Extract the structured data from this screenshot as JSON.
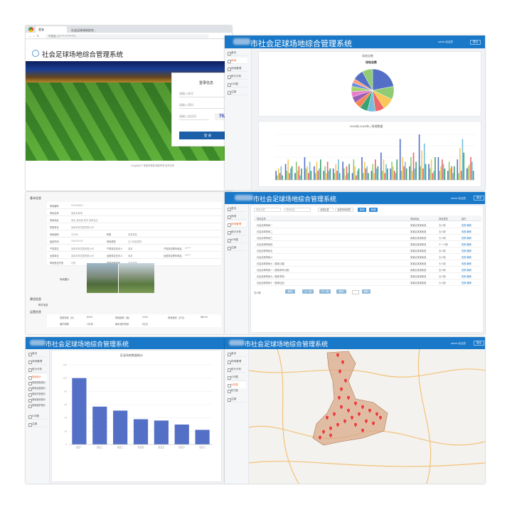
{
  "browser": {
    "tab1": "登录",
    "tab2": "社会足球场地综合...",
    "url": "不安全 | 1**.**.**.***:***/..."
  },
  "app_title": "社会足球场地综合管理系统",
  "app_title_full": "社会足球场地综合管理系统",
  "city_prefix": "市",
  "login": {
    "title": "登录信息",
    "user_placeholder": "请输入账号",
    "pass_placeholder": "请输入密码",
    "captcha_placeholder": "请输入验证码",
    "captcha": "T5J!",
    "button": "登 录",
    "footer": "Copyright © 某某体育局 版权所有 技术支持"
  },
  "user": {
    "name": "admin 欢迎您",
    "exit": "退出"
  },
  "nav": {
    "home": "首页",
    "stadium": "场地",
    "stadium_mgmt": "场地管理",
    "stats": "统计分析",
    "gis": "GIS图",
    "logout": "注销"
  },
  "dashboard": {
    "card1_title": "场地总数",
    "pie_title": "场地总数",
    "card2_title": "2016年-2020年 | 场地数量",
    "pie_colors": [
      "#5470c6",
      "#91cc75",
      "#fac858",
      "#ee6666",
      "#73c0de",
      "#3ba272",
      "#fc8452",
      "#9a60b4",
      "#ea7ccc",
      "#a5d36b",
      "#6b8ce0",
      "#ff9f7f"
    ]
  },
  "chart_data": [
    {
      "type": "pie",
      "title": "场地总数",
      "values": [
        22,
        10,
        9,
        7,
        6,
        6,
        5,
        5,
        4,
        4,
        3,
        3,
        8,
        8
      ]
    },
    {
      "type": "bar",
      "title": "2016年-2020年 | 场地数量",
      "series_count": 6,
      "categories": [
        "1",
        "2",
        "3",
        "4",
        "5",
        "6",
        "7",
        "8",
        "9",
        "10",
        "11",
        "12",
        "13",
        "14",
        "15",
        "16",
        "17",
        "18",
        "19",
        "20",
        "21"
      ],
      "series": [
        {
          "values": [
            4,
            7,
            3,
            10,
            6,
            4,
            5,
            8,
            3,
            10,
            4,
            12,
            5,
            18,
            6,
            20,
            7,
            10,
            4,
            9,
            5
          ]
        },
        {
          "values": [
            2,
            4,
            8,
            5,
            3,
            6,
            3,
            5,
            9,
            3,
            7,
            4,
            8,
            4,
            10,
            6,
            5,
            4,
            8,
            3,
            6
          ]
        },
        {
          "values": [
            5,
            9,
            4,
            6,
            8,
            3,
            7,
            2,
            6,
            8,
            3,
            9,
            6,
            10,
            4,
            13,
            9,
            6,
            5,
            14,
            7
          ]
        },
        {
          "values": [
            3,
            3,
            6,
            3,
            4,
            8,
            4,
            6,
            2,
            5,
            9,
            3,
            4,
            6,
            12,
            5,
            3,
            9,
            6,
            4,
            10
          ]
        },
        {
          "values": [
            6,
            5,
            2,
            8,
            5,
            4,
            9,
            3,
            4,
            6,
            5,
            7,
            3,
            8,
            5,
            16,
            4,
            7,
            3,
            18,
            8
          ]
        },
        {
          "values": [
            2,
            6,
            5,
            4,
            9,
            5,
            3,
            7,
            5,
            3,
            6,
            5,
            9,
            5,
            8,
            7,
            10,
            5,
            6,
            12,
            4
          ]
        }
      ]
    },
    {
      "type": "bar",
      "title": "区县场地数量统计",
      "categories": [
        "区县一",
        "区县二",
        "区县三",
        "区县四",
        "区县五",
        "区县六",
        "区县七"
      ],
      "values": [
        100,
        57,
        51,
        38,
        36,
        30,
        22
      ],
      "ylim": [
        0,
        120
      ]
    }
  ],
  "detail": {
    "section1": "基本信息",
    "section2": "建设信息",
    "section3": "附件信息",
    "section4": "场地图片",
    "section5": "运营信息",
    "rows": [
      [
        "场地编号",
        "SC0000001"
      ],
      [
        "场地名称",
        "某某足球场"
      ],
      [
        "场地地址",
        "某区 某街道 某号 某某社区"
      ],
      [
        "所属单位",
        "某某体育发展有限公司"
      ],
      [
        "场地面积",
        "平方米",
        "所属",
        "某某类型"
      ],
      [
        "建设时间",
        "2016-09-05",
        "场地类型",
        "五人制足球场"
      ],
      [
        "产权单位",
        "某某体育发展有限公司",
        "产权单位负责人",
        "某某",
        "产权单位联系电话",
        "13****"
      ],
      [
        "运营单位",
        "某某体育发展有限公司",
        "运营单位负责人",
        "某某",
        "运营单位联系电话",
        "13****"
      ],
      [
        "场地是否开放",
        "开放",
        "场地开放时间",
        "全天开放"
      ]
    ],
    "photo_label": "场地图片",
    "fee_label": "收费标准（元）",
    "fee_value": "80.00",
    "area_label": "场地面积（亩）",
    "area_value": "10.00",
    "invest_label": "场地投资（万元）",
    "invest_value": "860.00",
    "period_label": "维护周期",
    "period_value": "1次/年",
    "cost_label": "每年维护费用",
    "cost_value": "5万元"
  },
  "list": {
    "search_placeholder": "场地名称",
    "search_placeholder2": "场地地址",
    "select1": "全部区县",
    "select2": "全部场地类型",
    "search_btn": "查询",
    "add_btn": "新增",
    "headers": [
      "场地名称",
      "场地地址",
      "场地类型",
      "操作"
    ],
    "rows": [
      [
        "社会足球场地一",
        "某某区某某街道",
        "五人制",
        "查看 编辑"
      ],
      [
        "社会足球场地二",
        "某某区某某街道",
        "五人制",
        "查看 编辑"
      ],
      [
        "社会足球场地三",
        "某某区某某街道",
        "七人制",
        "查看 编辑"
      ],
      [
        "社会足球场地四",
        "某某区某某街道",
        "十一人制",
        "查看 编辑"
      ],
      [
        "社会足球场地五",
        "某某区某某街道",
        "五人制",
        "查看 编辑"
      ],
      [
        "社会足球场地六",
        "某某区某某街道",
        "五人制",
        "查看 编辑"
      ],
      [
        "社会足球场地七（某某公园）",
        "某某区某某街道",
        "七人制",
        "查看 编辑"
      ],
      [
        "社会足球场地八（某某体育公园）",
        "某某区某某街道",
        "五人制",
        "查看 编辑"
      ],
      [
        "社会足球场地九（某某学校）",
        "某某区某某街道",
        "五人制",
        "查看 编辑"
      ],
      [
        "社会足球场地十（某某社区）",
        "某某区某某街道",
        "七人制",
        "查看 编辑"
      ]
    ],
    "pager": [
      "首页",
      "上一页",
      "下一页",
      "尾页",
      "跳转"
    ]
  },
  "stats": {
    "sub1": "场地统计",
    "sub2": "场地类型统计",
    "sub3": "场地运营统计",
    "sub4": "场地开放统计",
    "sub5": "场地投资统计",
    "sub6": "场地维护统计",
    "chart_title": "区县场地数量统计"
  },
  "map": {
    "sub1": "分布图",
    "sub2": "热力图",
    "pin_color": "#e8423c",
    "region_color": "#d9a98a"
  }
}
